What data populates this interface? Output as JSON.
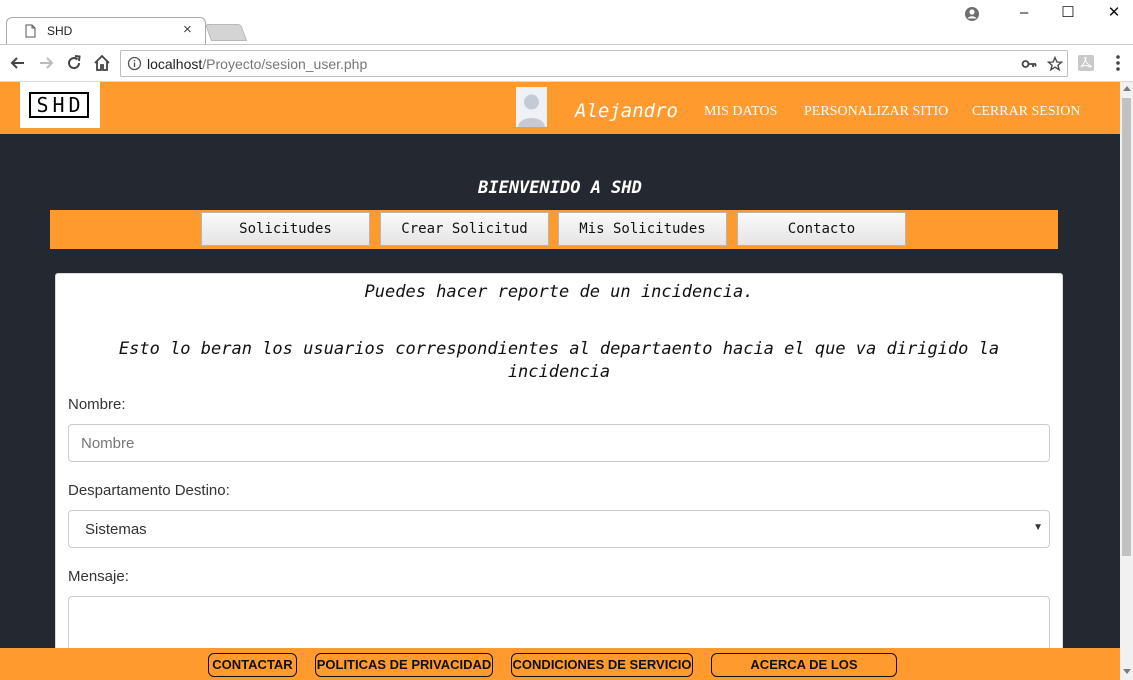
{
  "browser": {
    "tab_title": "SHD",
    "tab_close": "×",
    "url_host": "localhost",
    "url_path": "/Proyecto/sesion_user.php",
    "window_controls": {
      "minimize": "–",
      "maximize": "☐",
      "close": "✕"
    }
  },
  "header": {
    "logo_text": "SHD",
    "user_name": "Alejandro",
    "nav": [
      "MIS DATOS",
      "PERSONALIZAR SITIO",
      "CERRAR SESION"
    ]
  },
  "welcome": "BIENVENIDO A SHD",
  "menu": [
    "Solicitudes",
    "Crear Solicitud",
    "Mis Solicitudes",
    "Contacto"
  ],
  "form": {
    "intro_line1": "Puedes hacer reporte de un incidencia.",
    "intro_line2": "Esto lo beran los usuarios correspondientes al departaento hacia el que va dirigido la incidencia",
    "nombre_label": "Nombre:",
    "nombre_placeholder": "Nombre",
    "departamento_label": "Despartamento Destino:",
    "departamento_value": "Sistemas",
    "mensaje_label": "Mensaje:"
  },
  "footer": [
    "CONTACTAR",
    "POLITICAS DE PRIVACIDAD",
    "CONDICIONES DE SERVICIO",
    "ACERCA DE LOS CREADORES"
  ],
  "colors": {
    "accent": "#fe9a2e",
    "page_bg": "#242830",
    "card_bg": "#ffffff"
  },
  "icons": [
    "document-icon",
    "back-icon",
    "forward-icon",
    "reload-icon",
    "home-icon",
    "info-icon",
    "key-icon",
    "star-icon",
    "pdf-extension-icon",
    "menu-icon",
    "account-icon",
    "avatar-icon"
  ]
}
